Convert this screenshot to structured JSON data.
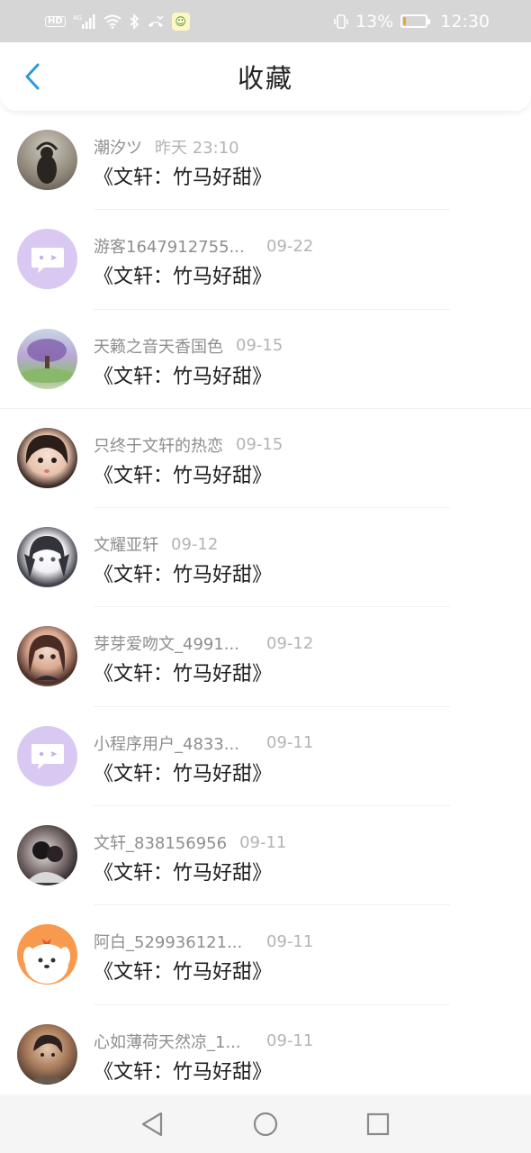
{
  "status_bar": {
    "left_icons": [
      "hd-icon",
      "4g-signal-icon",
      "wifi-icon",
      "bluetooth-icon",
      "missed-call-icon",
      "app-notification-icon"
    ],
    "hd_label": "HD",
    "network_label": "4G",
    "battery_percent": "13%",
    "time": "12:30",
    "battery_level": 0.13,
    "battery_color": "#f2a23a"
  },
  "header": {
    "title": "收藏",
    "back_color": "#2a9be0"
  },
  "favorites": [
    {
      "user": "潮汐ツ",
      "time": "昨天 23:10",
      "title": "《文轩：竹马好甜》"
    },
    {
      "user": "游客1647912755...",
      "time": "09-22",
      "title": "《文轩：竹马好甜》"
    },
    {
      "user": "天籁之音天香国色",
      "time": "09-15",
      "title": "《文轩：竹马好甜》"
    },
    {
      "user": "只终于文轩的热恋",
      "time": "09-15",
      "title": "《文轩：竹马好甜》"
    },
    {
      "user": "文耀亚轩",
      "time": "09-12",
      "title": "《文轩：竹马好甜》"
    },
    {
      "user": "芽芽爱吻文_4991...",
      "time": "09-12",
      "title": "《文轩：竹马好甜》"
    },
    {
      "user": "小程序用户_4833...",
      "time": "09-11",
      "title": "《文轩：竹马好甜》"
    },
    {
      "user": "文轩_838156956",
      "time": "09-11",
      "title": "《文轩：竹马好甜》"
    },
    {
      "user": "阿白_529936121...",
      "time": "09-11",
      "title": "《文轩：竹马好甜》"
    },
    {
      "user": "心如薄荷天然凉_1...",
      "time": "09-11",
      "title": "《文轩：竹马好甜》"
    }
  ],
  "nav": {
    "icons": [
      "back-triangle-icon",
      "home-circle-icon",
      "recents-square-icon"
    ]
  }
}
